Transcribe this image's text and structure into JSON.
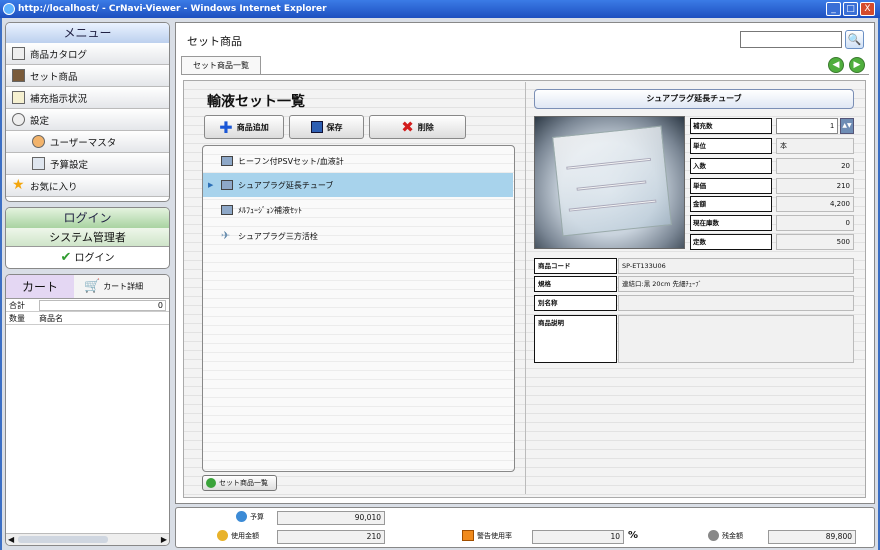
{
  "window": {
    "title": "http://localhost/ - CrNavi-Viewer - Windows Internet Explorer",
    "min": "_",
    "max": "□",
    "close": "X"
  },
  "menu": {
    "title": "メニュー",
    "items": [
      {
        "label": "商品カタログ",
        "icon": "catalog-icon"
      },
      {
        "label": "セット商品",
        "icon": "set-product-icon"
      },
      {
        "label": "補充指示状況",
        "icon": "replenish-icon"
      },
      {
        "label": "設定",
        "icon": "settings-icon"
      },
      {
        "label": "ユーザーマスタ",
        "icon": "user-icon",
        "sub": true
      },
      {
        "label": "予算設定",
        "icon": "budget-icon",
        "sub": true
      },
      {
        "label": "お気に入り",
        "icon": "star-icon"
      }
    ]
  },
  "login": {
    "title": "ログイン",
    "user": "システム管理者",
    "button": "ログイン"
  },
  "cart": {
    "tab": "カート",
    "detail_tab": "カート詳細",
    "total_label": "合計",
    "total_value": "0",
    "col_qty": "数量",
    "col_name": "商品名"
  },
  "main": {
    "title": "セット商品",
    "search": {
      "value": "",
      "button": "🔍"
    },
    "subtab": "セット商品一覧",
    "nav_back": "◀",
    "nav_forward": "▶"
  },
  "setlist": {
    "title": "輸液セット一覧",
    "add": "商品追加",
    "save": "保存",
    "delete": "削除",
    "items": [
      {
        "label": "ヒーフン付PSVセット/血液計",
        "selected": false
      },
      {
        "label": "シュアプラグ延長チューブ",
        "selected": true
      },
      {
        "label": "ﾒﾙﾌｭｰｼﾞｮﾝ補液ｾｯﾄ",
        "selected": false
      },
      {
        "label": "シュアプラグ三方活栓",
        "selected": false
      }
    ],
    "back_button": "セット商品一覧"
  },
  "detail": {
    "title": "シュアプラグ延長チューブ",
    "fields": [
      {
        "label": "補充数",
        "value": "1"
      },
      {
        "label": "単位",
        "value": "本"
      },
      {
        "label": "入数",
        "value": "20"
      },
      {
        "label": "単価",
        "value": "210"
      },
      {
        "label": "金額",
        "value": "4,200"
      },
      {
        "label": "現在庫数",
        "value": "0"
      },
      {
        "label": "定数",
        "value": "500"
      }
    ],
    "code_label": "商品コード",
    "code_value": "SP-ET133U06",
    "spec_label": "規格",
    "spec_value": "連結口:黒 20cm 先細ﾁｭｰﾌﾞ",
    "alt_label": "別名称",
    "alt_value": "",
    "desc_label": "商品説明",
    "desc_value": ""
  },
  "footer": {
    "budget_label": "予算",
    "budget_value": "90,010",
    "used_label": "使用金額",
    "used_value": "210",
    "warn_label": "警告使用率",
    "warn_value": "10",
    "warn_unit": "%",
    "remain_label": "残金額",
    "remain_value": "89,800"
  }
}
